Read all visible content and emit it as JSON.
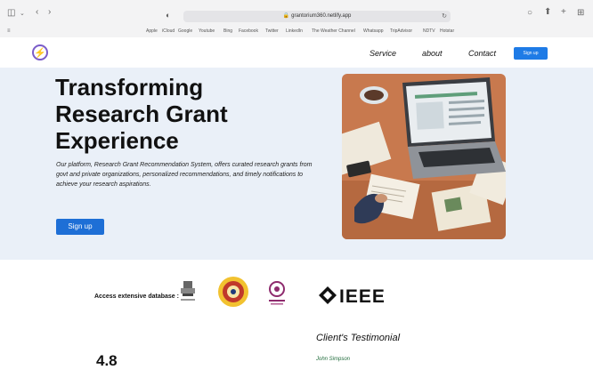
{
  "browser": {
    "url": "grantorium360.netlify.app",
    "favorites": [
      "Apple",
      "iCloud",
      "Google",
      "Youtube",
      "Bing",
      "Facebook",
      "Twitter",
      "LinkedIn",
      "The Weather Channel",
      "Whatsapp",
      "TripAdvisor",
      "NDTV",
      "Hotstar"
    ]
  },
  "nav": {
    "links": [
      "Service",
      "about",
      "Contact"
    ],
    "signup_label": "Sign up"
  },
  "hero": {
    "title_lines": [
      "Transforming",
      "Research Grant",
      "Experience"
    ],
    "description": "Our platform, Research Grant Recommendation System, offers curated research grants from govt and private organizations, personalized recommendations, and timely notifications to achieve your research aspirations.",
    "button_label": "Sign up"
  },
  "partners": {
    "label": "Access extensive database :",
    "ieee_text": "IEEE"
  },
  "testimonial": {
    "heading": "Client's Testimonial",
    "name": "John Simpson",
    "rating": "4.8"
  }
}
